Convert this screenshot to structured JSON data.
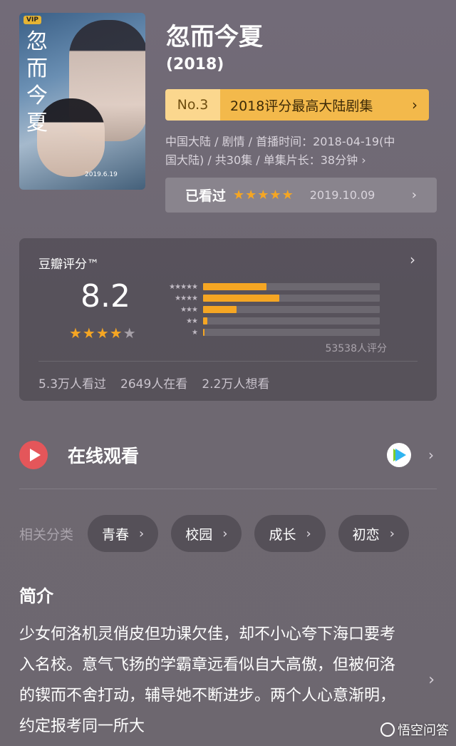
{
  "poster": {
    "badge": "VIP",
    "title_text": "忽而今夏",
    "date_text": "2019.6.19"
  },
  "title": "忽而今夏",
  "year": "(2018)",
  "rank": {
    "no": "No.3",
    "text": "2018评分最高大陆剧集"
  },
  "meta_line1": "中国大陆 / 剧情 / 首播时间：2018-04-19(中",
  "meta_line2": "国大陆) / 共30集 / 单集片长：38分钟",
  "watched": {
    "label": "已看过",
    "stars": 5,
    "date": "2019.10.09"
  },
  "rating": {
    "title": "豆瓣评分™",
    "score": "8.2",
    "stars_on": 4,
    "stars_off": 1,
    "count": "53538人评分",
    "distribution": [
      {
        "stars": "★★★★★",
        "fraction": 0.36
      },
      {
        "stars": "★★★★",
        "fraction": 0.43
      },
      {
        "stars": "★★★",
        "fraction": 0.19
      },
      {
        "stars": "★★",
        "fraction": 0.025
      },
      {
        "stars": "★",
        "fraction": 0.008
      }
    ],
    "stats": [
      "5.3万人看过",
      "2649人在看",
      "2.2万人想看"
    ]
  },
  "online": {
    "label": "在线观看"
  },
  "categories": {
    "label": "相关分类",
    "tags": [
      "青春",
      "校园",
      "成长",
      "初恋"
    ]
  },
  "intro": {
    "title": "简介",
    "text": "少女何洛机灵俏皮但功课欠佳，却不小心夸下海口要考入名校。意气飞扬的学霸章远看似自大高傲，但被何洛的锲而不舍打动，辅导她不断进步。两个人心意渐明，约定报考同一所大"
  },
  "watermark": "悟空问答",
  "colors": {
    "accent": "#f5a623",
    "rank_no_bg": "#fbd78e",
    "rank_bg": "#f3b94b",
    "play": "#e4565a"
  }
}
